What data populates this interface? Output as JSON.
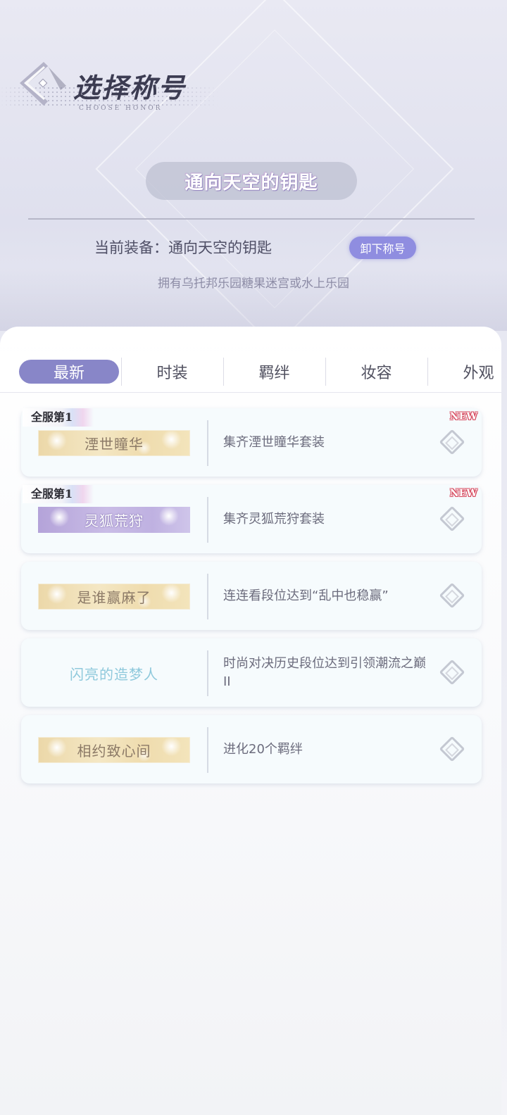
{
  "header": {
    "title": "选择称号",
    "subtitle": "CHOOSE HONOR",
    "current_title": "通向天空的钥匙",
    "equip_label": "当前装备：通向天空的钥匙",
    "unequip_button": "卸下称号",
    "equip_description": "拥有乌托邦乐园糖果迷宫或水上乐园"
  },
  "tabs": [
    {
      "label": "最新",
      "active": true
    },
    {
      "label": "时装",
      "active": false
    },
    {
      "label": "羁绊",
      "active": false
    },
    {
      "label": "妆容",
      "active": false
    },
    {
      "label": "外观",
      "active": false
    }
  ],
  "titles": [
    {
      "name": "湮世瞳华",
      "description": "集齐湮世瞳华套装",
      "rank_badge": "全服第1",
      "new_tag": "NEW",
      "style": "gold"
    },
    {
      "name": "灵狐荒狩",
      "description": "集齐灵狐荒狩套装",
      "rank_badge": "全服第1",
      "new_tag": "NEW",
      "style": "purple"
    },
    {
      "name": "是谁赢麻了",
      "description": "连连看段位达到“乱中也稳赢”",
      "rank_badge": "",
      "new_tag": "",
      "style": "gold"
    },
    {
      "name": "闪亮的造梦人",
      "description": "时尚对决历史段位达到引领潮流之巅 II",
      "rank_badge": "",
      "new_tag": "",
      "style": "plain"
    },
    {
      "name": "相约致心间",
      "description": "进化20个羁绊",
      "rank_badge": "",
      "new_tag": "",
      "style": "gold"
    }
  ],
  "colors": {
    "accent": "#8886c8",
    "unequip_button": "#8f8de0",
    "new_tag": "#d5445a"
  }
}
